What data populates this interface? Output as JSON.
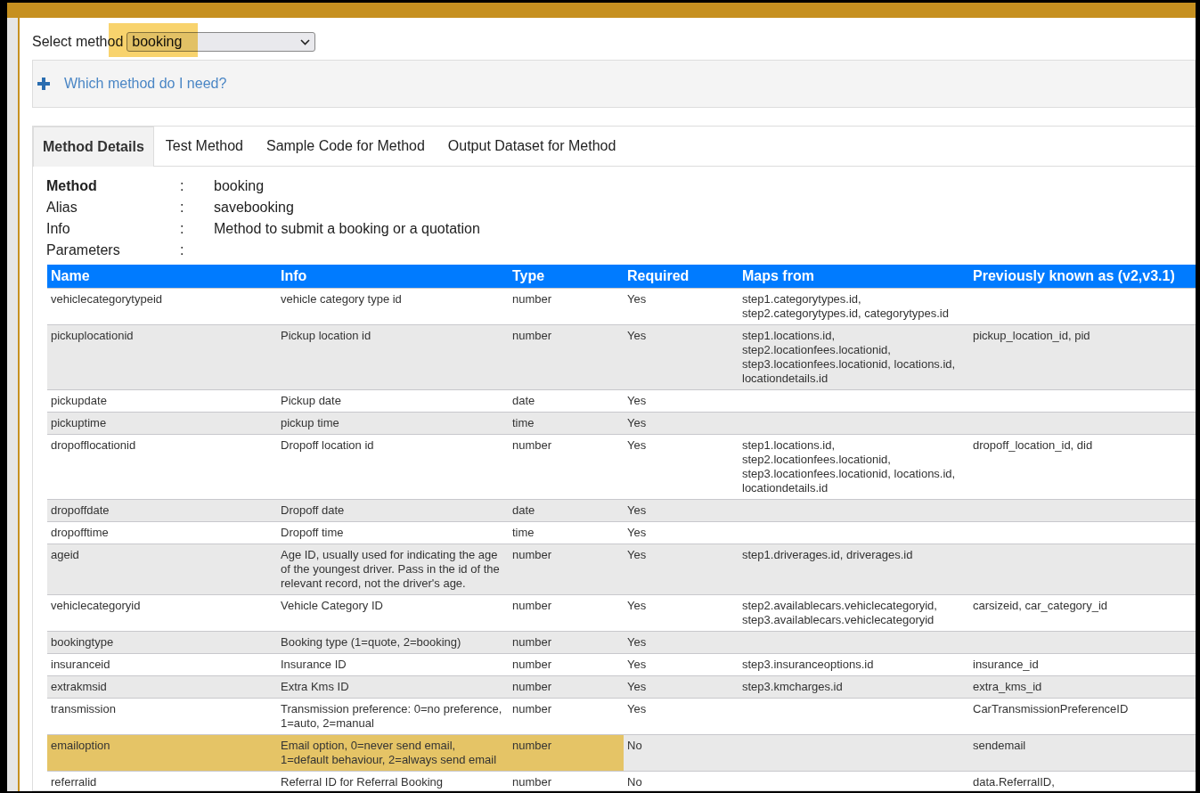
{
  "select_method": {
    "label": "Select method",
    "value": "booking",
    "highlighted": true
  },
  "help_panel": {
    "title": "Which method do I need?",
    "expanded": false
  },
  "tabs": [
    {
      "label": "Method Details",
      "selected": true
    },
    {
      "label": "Test Method",
      "selected": false
    },
    {
      "label": "Sample Code for Method",
      "selected": false
    },
    {
      "label": "Output Dataset for Method",
      "selected": false
    }
  ],
  "details": [
    {
      "label": "Method",
      "separator": ":",
      "value": "booking"
    },
    {
      "label": "Alias",
      "separator": ":",
      "value": "savebooking"
    },
    {
      "label": "Info",
      "separator": ":",
      "value": "Method to submit a booking or a quotation"
    },
    {
      "label": "Parameters",
      "separator": ":"
    }
  ],
  "parameters": {
    "columns": [
      "Name",
      "Info",
      "Type",
      "Required",
      "Maps from",
      "Previously known as (v2,v3.1)"
    ],
    "rows": [
      {
        "cells": [
          "vehiclecategorytypeid",
          "vehicle category type id",
          "number",
          "Yes",
          "step1.categorytypes.id, step2.categorytypes.id, categorytypes.id",
          ""
        ],
        "highlighted": false
      },
      {
        "cells": [
          "pickuplocationid",
          "Pickup location id",
          "number",
          "Yes",
          "step1.locations.id, step2.locationfees.locationid, step3.locationfees.locationid, locations.id, locationdetails.id",
          "pickup_location_id, pid"
        ],
        "highlighted": false
      },
      {
        "cells": [
          "pickupdate",
          "Pickup date",
          "date",
          "Yes",
          "",
          ""
        ],
        "highlighted": false
      },
      {
        "cells": [
          "pickuptime",
          "pickup time",
          "time",
          "Yes",
          "",
          ""
        ],
        "highlighted": false
      },
      {
        "cells": [
          "dropofflocationid",
          "Dropoff location id",
          "number",
          "Yes",
          "step1.locations.id, step2.locationfees.locationid, step3.locationfees.locationid, locations.id, locationdetails.id",
          "dropoff_location_id, did"
        ],
        "highlighted": false
      },
      {
        "cells": [
          "dropoffdate",
          "Dropoff date",
          "date",
          "Yes",
          "",
          ""
        ],
        "highlighted": false
      },
      {
        "cells": [
          "dropofftime",
          "Dropoff time",
          "time",
          "Yes",
          "",
          ""
        ],
        "highlighted": false
      },
      {
        "cells": [
          "ageid",
          "Age ID, usually used for indicating the age of the youngest driver. Pass in the id of the relevant record, not the driver's age.",
          "number",
          "Yes",
          "step1.driverages.id, driverages.id",
          ""
        ],
        "highlighted": false
      },
      {
        "cells": [
          "vehiclecategoryid",
          "Vehicle Category ID",
          "number",
          "Yes",
          "step2.availablecars.vehiclecategoryid, step3.availablecars.vehiclecategoryid",
          "carsizeid, car_category_id"
        ],
        "highlighted": false
      },
      {
        "cells": [
          "bookingtype",
          "Booking type (1=quote, 2=booking)",
          "number",
          "Yes",
          "",
          ""
        ],
        "highlighted": false
      },
      {
        "cells": [
          "insuranceid",
          "Insurance ID",
          "number",
          "Yes",
          "step3.insuranceoptions.id",
          "insurance_id"
        ],
        "highlighted": false
      },
      {
        "cells": [
          "extrakmsid",
          "Extra Kms ID",
          "number",
          "Yes",
          "step3.kmcharges.id",
          "extra_kms_id"
        ],
        "highlighted": false
      },
      {
        "cells": [
          "transmission",
          "Transmission preference: 0=no preference, 1=auto, 2=manual",
          "number",
          "Yes",
          "",
          "CarTransmissionPreferenceID"
        ],
        "highlighted": false
      },
      {
        "cells": [
          "emailoption",
          "Email option, 0=never send email, 1=default behaviour, 2=always send email",
          "number",
          "No",
          "",
          "sendemail"
        ],
        "highlighted": true
      },
      {
        "cells": [
          "referralid",
          "Referral ID for Referral Booking",
          "number",
          "No",
          "",
          "data.ReferralID,"
        ],
        "highlighted": false
      }
    ]
  }
}
